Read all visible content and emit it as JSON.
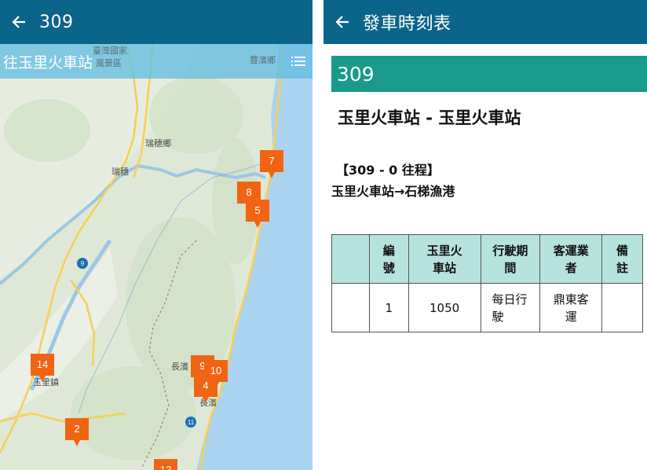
{
  "left_panel": {
    "header": {
      "title": "309"
    },
    "direction": {
      "label": "往玉里火車站"
    },
    "map": {
      "place_labels": [
        "瑞穗鄉",
        "瑞穗",
        "玉里鎮",
        "長濱",
        "長濱",
        "豐濱鄉",
        "臺灣國家",
        "風景區"
      ],
      "road_shields": [
        "9",
        "11"
      ],
      "markers": [
        "7",
        "8",
        "5",
        "14",
        "9",
        "10",
        "4",
        "2",
        "12"
      ],
      "colors": {
        "marker": "#f06414",
        "sea": "#aad3ef",
        "land": "#dfe8d6"
      }
    }
  },
  "right_panel": {
    "header": {
      "title": "發車時刻表"
    },
    "route_number": "309",
    "route_name": "玉里火車站 - 玉里火車站",
    "trip": {
      "code": "【309 - 0 往程】",
      "path": "玉里火車站→石梯漁港"
    },
    "table": {
      "headers": [
        "",
        "編\n號",
        "玉里火\n車站",
        "行駛期\n間",
        "客運業\n者",
        "備\n註"
      ],
      "rows": [
        [
          "",
          "1",
          "1050",
          "每日行\n駛",
          "鼎東客\n運",
          ""
        ]
      ]
    },
    "colors": {
      "header_bar": "#0b6489",
      "route_strip": "#199a8b",
      "table_header": "#b7e3de"
    }
  }
}
